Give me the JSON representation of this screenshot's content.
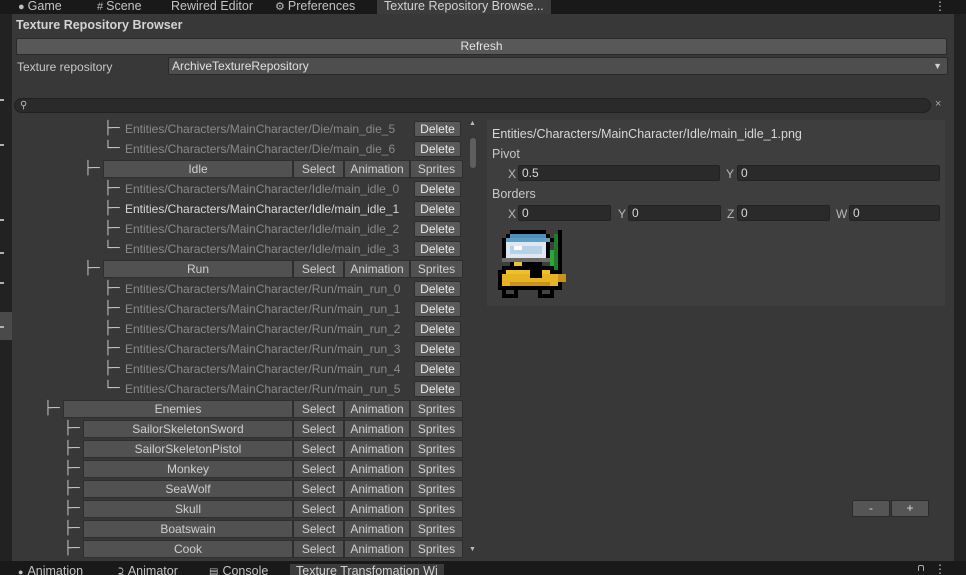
{
  "top_tabs": [
    {
      "label": "Game",
      "icon": "gamepad-icon",
      "glyph": "●"
    },
    {
      "label": "Scene",
      "icon": "grid-icon",
      "glyph": "#"
    },
    {
      "label": "Rewired Editor",
      "icon": "",
      "glyph": ""
    },
    {
      "label": "Preferences",
      "icon": "gear-icon",
      "glyph": "⚙"
    },
    {
      "label": "Texture Repository Browse...",
      "icon": "",
      "glyph": ""
    }
  ],
  "window": {
    "title": "Texture Repository Browser",
    "refresh_label": "Refresh",
    "repo_label": "Texture repository",
    "repo_value": "ArchiveTextureRepository",
    "clear_glyph": "×"
  },
  "tree": {
    "rows": [
      {
        "kind": "file",
        "branch": "├─",
        "path": "Entities/Characters/MainCharacter/Die/main_die_5",
        "hl": false,
        "btn": "Delete"
      },
      {
        "kind": "file",
        "branch": "└─",
        "path": "Entities/Characters/MainCharacter/Die/main_die_6",
        "hl": false,
        "btn": "Delete"
      },
      {
        "kind": "group",
        "branch": "├─",
        "label": "Idle",
        "depth": 2,
        "btns": [
          "Select",
          "Animation",
          "Sprites"
        ]
      },
      {
        "kind": "file",
        "branch": "├─",
        "path": "Entities/Characters/MainCharacter/Idle/main_idle_0",
        "hl": false,
        "btn": "Delete"
      },
      {
        "kind": "file",
        "branch": "├─",
        "path": "Entities/Characters/MainCharacter/Idle/main_idle_1",
        "hl": true,
        "btn": "Delete"
      },
      {
        "kind": "file",
        "branch": "├─",
        "path": "Entities/Characters/MainCharacter/Idle/main_idle_2",
        "hl": false,
        "btn": "Delete"
      },
      {
        "kind": "file",
        "branch": "└─",
        "path": "Entities/Characters/MainCharacter/Idle/main_idle_3",
        "hl": false,
        "btn": "Delete"
      },
      {
        "kind": "group",
        "branch": "├─",
        "label": "Run",
        "depth": 2,
        "btns": [
          "Select",
          "Animation",
          "Sprites"
        ]
      },
      {
        "kind": "file",
        "branch": "├─",
        "path": "Entities/Characters/MainCharacter/Run/main_run_0",
        "hl": false,
        "btn": "Delete"
      },
      {
        "kind": "file",
        "branch": "├─",
        "path": "Entities/Characters/MainCharacter/Run/main_run_1",
        "hl": false,
        "btn": "Delete"
      },
      {
        "kind": "file",
        "branch": "├─",
        "path": "Entities/Characters/MainCharacter/Run/main_run_2",
        "hl": false,
        "btn": "Delete"
      },
      {
        "kind": "file",
        "branch": "├─",
        "path": "Entities/Characters/MainCharacter/Run/main_run_3",
        "hl": false,
        "btn": "Delete"
      },
      {
        "kind": "file",
        "branch": "├─",
        "path": "Entities/Characters/MainCharacter/Run/main_run_4",
        "hl": false,
        "btn": "Delete"
      },
      {
        "kind": "file",
        "branch": "└─",
        "path": "Entities/Characters/MainCharacter/Run/main_run_5",
        "hl": false,
        "btn": "Delete"
      },
      {
        "kind": "group",
        "branch": "├─",
        "label": "Enemies",
        "depth": 0,
        "btns": [
          "Select",
          "Animation",
          "Sprites"
        ]
      },
      {
        "kind": "group",
        "branch": "├─",
        "label": "SailorSkeletonSword",
        "depth": 1,
        "btns": [
          "Select",
          "Animation",
          "Sprites"
        ]
      },
      {
        "kind": "group",
        "branch": "├─",
        "label": "SailorSkeletonPistol",
        "depth": 1,
        "btns": [
          "Select",
          "Animation",
          "Sprites"
        ]
      },
      {
        "kind": "group",
        "branch": "├─",
        "label": "Monkey",
        "depth": 1,
        "btns": [
          "Select",
          "Animation",
          "Sprites"
        ]
      },
      {
        "kind": "group",
        "branch": "├─",
        "label": "SeaWolf",
        "depth": 1,
        "btns": [
          "Select",
          "Animation",
          "Sprites"
        ]
      },
      {
        "kind": "group",
        "branch": "├─",
        "label": "Skull",
        "depth": 1,
        "btns": [
          "Select",
          "Animation",
          "Sprites"
        ]
      },
      {
        "kind": "group",
        "branch": "├─",
        "label": "Boatswain",
        "depth": 1,
        "btns": [
          "Select",
          "Animation",
          "Sprites"
        ]
      },
      {
        "kind": "group",
        "branch": "├─",
        "label": "Cook",
        "depth": 1,
        "btns": [
          "Select",
          "Animation",
          "Sprites"
        ]
      }
    ]
  },
  "detail": {
    "path": "Entities/Characters/MainCharacter/Idle/main_idle_1.png",
    "pivot_label": "Pivot",
    "pivot_x_label": "X",
    "pivot_x": "0.5",
    "pivot_y_label": "Y",
    "pivot_y": "0",
    "borders_label": "Borders",
    "bx_label": "X",
    "bx": "0",
    "by_label": "Y",
    "by": "0",
    "bz_label": "Z",
    "bz": "0",
    "bw_label": "W",
    "bw": "0",
    "minus_label": "-",
    "plus_label": "+"
  },
  "bottom_tabs": [
    {
      "label": "Animation",
      "icon": "animation-icon",
      "glyph": "●"
    },
    {
      "label": "Animator",
      "icon": "animator-icon",
      "glyph": "⫈"
    },
    {
      "label": "Console",
      "icon": "console-icon",
      "glyph": "▤"
    },
    {
      "label": "Texture Transfomation Wi",
      "icon": "",
      "glyph": ""
    }
  ]
}
